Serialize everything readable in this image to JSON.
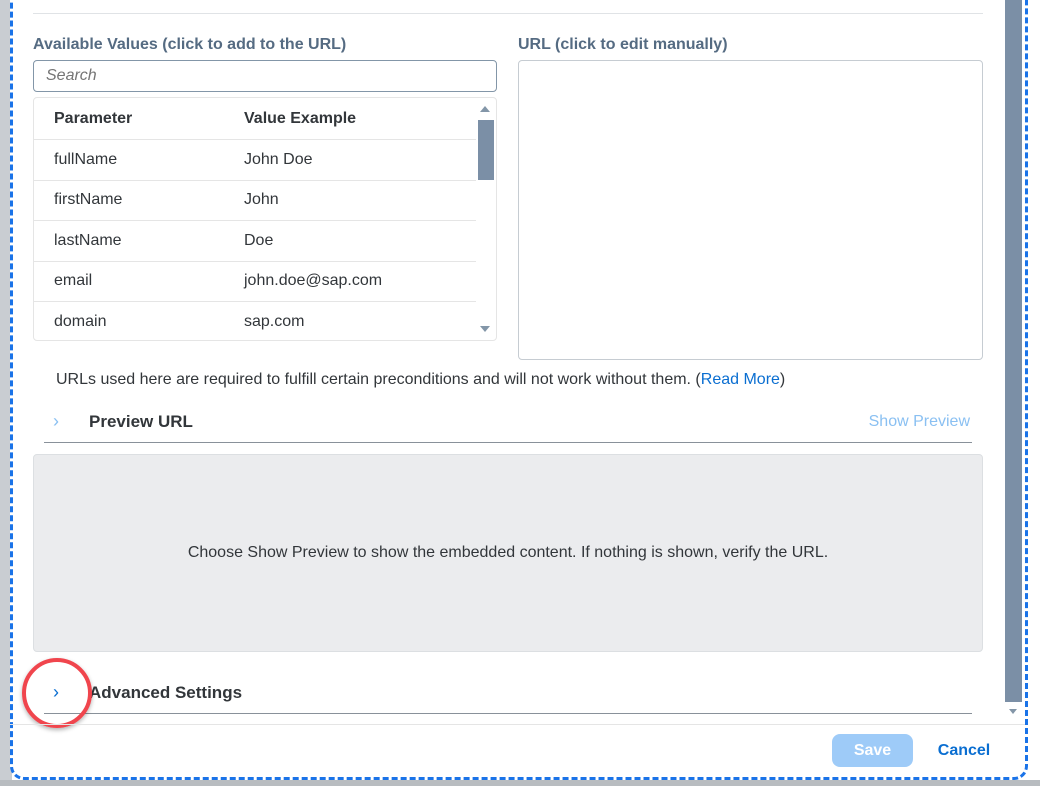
{
  "available_values": {
    "label": "Available Values (click to add to the URL)",
    "search_placeholder": "Search",
    "columns": [
      "Parameter",
      "Value Example"
    ],
    "rows": [
      [
        "fullName",
        "John Doe"
      ],
      [
        "firstName",
        "John"
      ],
      [
        "lastName",
        "Doe"
      ],
      [
        "email",
        "john.doe@sap.com"
      ],
      [
        "domain",
        "sap.com"
      ]
    ]
  },
  "url": {
    "label": "URL (click to edit manually)",
    "value": ""
  },
  "note": {
    "text": "URLs used here are required to fulfill certain preconditions and will not work without them. (",
    "link": "Read More",
    "end": ")"
  },
  "preview": {
    "title": "Preview URL",
    "show_preview": "Show Preview",
    "message": "Choose Show Preview to show the embedded content. If nothing is shown, verify the URL."
  },
  "advanced": {
    "title": "Advanced Settings"
  },
  "footer": {
    "save": "Save",
    "cancel": "Cancel"
  },
  "icons": {
    "chevron": "›"
  }
}
